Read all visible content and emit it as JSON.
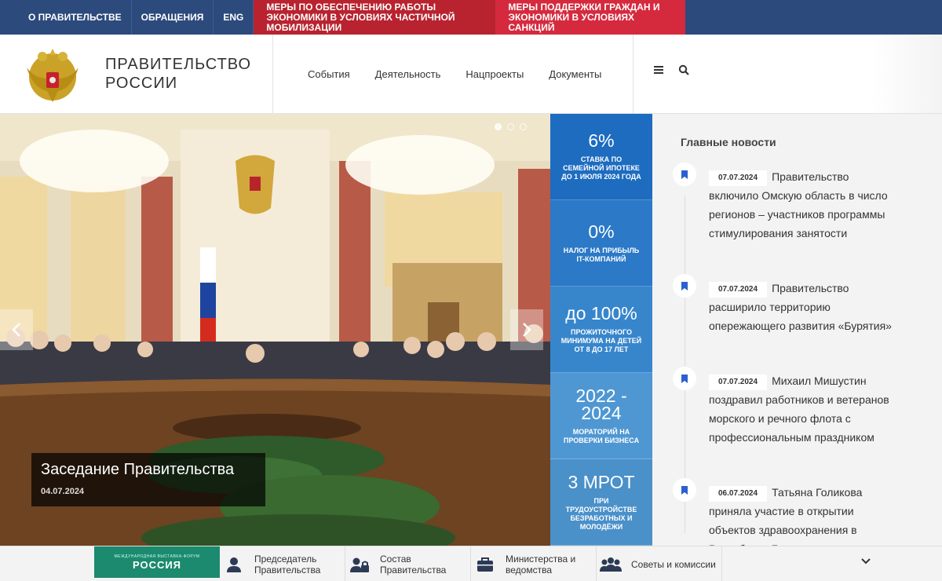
{
  "topbar": {
    "links": [
      "О ПРАВИТЕЛЬСТВЕ",
      "ОБРАЩЕНИЯ",
      "ENG"
    ],
    "promo1": "Меры по обеспечению работы экономики в условиях частичной мобилизации",
    "promo2": "Меры поддержки граждан и экономики в условиях санкций"
  },
  "header": {
    "brand": "ПРАВИТЕЛЬСТВО РОССИИ",
    "nav": [
      "События",
      "Деятельность",
      "Нацпроекты",
      "Документы"
    ],
    "icons": [
      "menu-icon",
      "search-icon"
    ]
  },
  "hero": {
    "title": "Заседание Правительства",
    "date": "04.07.2024",
    "slides_total": 3,
    "active_slide": 1
  },
  "stats": [
    {
      "value": "6%",
      "desc": "Ставка по семейной ипотеке до 1 июля 2024 года",
      "color": "#1d6cc0"
    },
    {
      "value": "0%",
      "desc": "Налог на прибыль IT-компаний",
      "color": "#2b79c7"
    },
    {
      "value": "до 100%",
      "desc": "прожиточного минимума на детей от 8 до 17 лет",
      "color": "#3786cc"
    },
    {
      "value": "2022 - 2024",
      "desc": "Мораторий на проверки бизнеса",
      "color": "#4f97d3"
    },
    {
      "value": "3 МРОТ",
      "desc": "при трудоустройстве безработных и молодёжи",
      "color": "#4a90c9"
    }
  ],
  "news": {
    "heading": "Главные новости",
    "items": [
      {
        "date": "07.07.2024",
        "text": "Правительство включило Омскую область в число регионов – участников программы стимулирования занятости"
      },
      {
        "date": "07.07.2024",
        "text": "Правительство расширило территорию опережающего развития «Бурятия»"
      },
      {
        "date": "07.07.2024",
        "text": "Михаил Мишустин поздравил работников и ветеранов морского и речного флота с профессиональным праздником"
      },
      {
        "date": "06.07.2024",
        "text": "Татьяна Голикова приняла участие в открытии объектов здравоохранения в Республике Бурятия"
      }
    ]
  },
  "bottombar": {
    "logo_small": "МЕЖДУНАРОДНАЯ ВЫСТАВКА-ФОРУМ",
    "logo_big": "РОССИЯ",
    "items": [
      {
        "label": "Председатель Правительства",
        "icon": "person-icon"
      },
      {
        "label": "Состав Правительства",
        "icon": "people-icon"
      },
      {
        "label": "Министерства и ведомства",
        "icon": "briefcase-icon"
      },
      {
        "label": "Советы и комиссии",
        "icon": "group-icon"
      }
    ]
  },
  "colors": {
    "topbar": "#2c4a7c",
    "promo1": "#b8232f",
    "promo2": "#d52a3e",
    "accent": "#1d6cc0"
  }
}
